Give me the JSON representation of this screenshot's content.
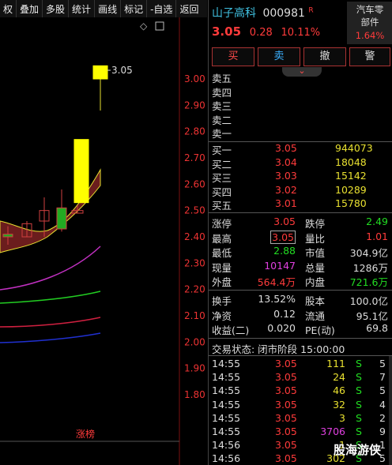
{
  "toolbar": {
    "items": [
      {
        "label": "权"
      },
      {
        "label": "叠加"
      },
      {
        "label": "多股"
      },
      {
        "label": "统计"
      },
      {
        "label": "画线"
      },
      {
        "label": "标记"
      },
      {
        "label": "-自选"
      },
      {
        "label": "返回"
      }
    ]
  },
  "chart": {
    "last_price_label": "3.05",
    "zt_label": "涨榜",
    "diamond": "◇",
    "yticks": [
      "3.00",
      "2.90",
      "2.80",
      "2.70",
      "2.60",
      "2.50",
      "2.40",
      "2.30",
      "2.20",
      "2.10",
      "2.00",
      "1.90",
      "1.80"
    ]
  },
  "chart_data": {
    "type": "candlestick",
    "ylim": [
      1.75,
      3.1
    ],
    "candles": [
      {
        "o": 2.41,
        "h": 2.44,
        "l": 2.37,
        "c": 2.4
      },
      {
        "o": 2.4,
        "h": 2.46,
        "l": 2.4,
        "c": 2.45
      },
      {
        "o": 2.46,
        "h": 2.55,
        "l": 2.4,
        "c": 2.5
      },
      {
        "o": 2.51,
        "h": 2.58,
        "l": 2.42,
        "c": 2.43
      },
      {
        "o": 2.49,
        "h": 2.52,
        "l": 2.49,
        "c": 2.5
      },
      {
        "o": 2.53,
        "h": 2.77,
        "l": 2.53,
        "c": 2.77
      },
      {
        "o": 3.0,
        "h": 3.05,
        "l": 2.88,
        "c": 3.05
      }
    ]
  },
  "stock": {
    "name": "山子高科",
    "code": "000981",
    "flag": "R",
    "price": "3.05",
    "change": "0.28",
    "pct": "10.11%",
    "sector_name": "汽车零部件",
    "sector_pct": "1.64%"
  },
  "buttons": {
    "buy": "买",
    "sell": "卖",
    "cancel": "撤",
    "alert": "警",
    "expand": "⌄"
  },
  "asks": [
    {
      "label": "卖五"
    },
    {
      "label": "卖四"
    },
    {
      "label": "卖三"
    },
    {
      "label": "卖二"
    },
    {
      "label": "卖一"
    }
  ],
  "bids": [
    {
      "label": "买一",
      "price": "3.05",
      "vol": "944073"
    },
    {
      "label": "买二",
      "price": "3.04",
      "vol": "18048"
    },
    {
      "label": "买三",
      "price": "3.03",
      "vol": "15142"
    },
    {
      "label": "买四",
      "price": "3.02",
      "vol": "10289"
    },
    {
      "label": "买五",
      "price": "3.01",
      "vol": "15780"
    }
  ],
  "stats": [
    {
      "l1": "涨停",
      "v1": "3.05",
      "l2": "跌停",
      "v2": "2.49"
    },
    {
      "l1": "最高",
      "v1": "3.05",
      "l2": "量比",
      "v2": "1.01"
    },
    {
      "l1": "最低",
      "v1": "2.88",
      "l2": "市值",
      "v2": "304.9亿"
    },
    {
      "l1": "现量",
      "v1": "10147",
      "l2": "总量",
      "v2": "1286万"
    },
    {
      "l1": "外盘",
      "v1": "564.4万",
      "l2": "内盘",
      "v2": "721.6万"
    }
  ],
  "stats2": [
    {
      "l1": "换手",
      "v1": "13.52%",
      "l2": "股本",
      "v2": "100.0亿"
    },
    {
      "l1": "净资",
      "v1": "0.12",
      "l2": "流通",
      "v2": "95.1亿"
    },
    {
      "l1": "收益(二)",
      "v1": "0.020",
      "l2": "PE(动)",
      "v2": "69.8"
    }
  ],
  "trade_status": "交易状态: 闭市阶段 15:00:00",
  "ticks": [
    {
      "time": "14:55",
      "price": "3.05",
      "vol": "111",
      "side": "S",
      "n": "5"
    },
    {
      "time": "14:55",
      "price": "3.05",
      "vol": "24",
      "side": "S",
      "n": "7"
    },
    {
      "time": "14:55",
      "price": "3.05",
      "vol": "46",
      "side": "S",
      "n": "5"
    },
    {
      "time": "14:55",
      "price": "3.05",
      "vol": "32",
      "side": "S",
      "n": "4"
    },
    {
      "time": "14:55",
      "price": "3.05",
      "vol": "3",
      "side": "S",
      "n": "2"
    },
    {
      "time": "14:55",
      "price": "3.05",
      "vol": "3706",
      "side": "S",
      "n": "9"
    },
    {
      "time": "14:56",
      "price": "3.05",
      "vol": "1",
      "side": "S",
      "n": "1"
    },
    {
      "time": "14:56",
      "price": "3.05",
      "vol": "302",
      "side": "S",
      "n": "5"
    }
  ],
  "watermark": "股海游侠"
}
